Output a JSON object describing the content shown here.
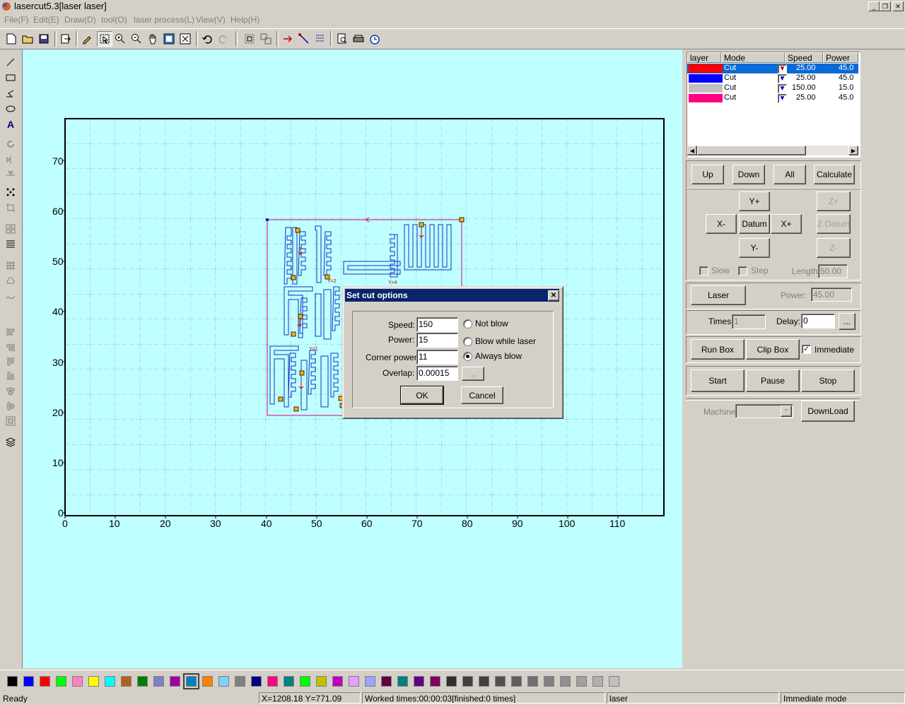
{
  "window": {
    "title": "lasercut5.3[laser laser]"
  },
  "menu": [
    "File(F)",
    "Edit(E)",
    "Draw(D)",
    "tool(O)",
    "laser process(L)",
    "View(V)",
    "Help(H)"
  ],
  "canvas": {
    "y_ticks": [
      "70",
      "60",
      "50",
      "40",
      "30",
      "20",
      "10",
      "0"
    ],
    "x_ticks": [
      "0",
      "10",
      "20",
      "30",
      "40",
      "50",
      "60",
      "70",
      "80",
      "90",
      "100",
      "110"
    ]
  },
  "layers": {
    "headers": [
      "layer",
      "Mode",
      "Speed",
      "Power"
    ],
    "rows": [
      {
        "color": "#ff0000",
        "mode": "Cut",
        "speed": "25.00",
        "power": "45.0",
        "selected": true
      },
      {
        "color": "#0000ff",
        "mode": "Cut",
        "speed": "25.00",
        "power": "45.0",
        "selected": false
      },
      {
        "color": "#c0c0c0",
        "mode": "Cut",
        "speed": "150.00",
        "power": "15.0",
        "selected": false
      },
      {
        "color": "#ff0080",
        "mode": "Cut",
        "speed": "25.00",
        "power": "45.0",
        "selected": false
      }
    ]
  },
  "panel": {
    "up": "Up",
    "down": "Down",
    "all": "All",
    "calculate": "Calculate",
    "yplus": "Y+",
    "xminus": "X-",
    "datum": "Datum",
    "xplus": "X+",
    "yminus": "Y-",
    "zplus": "Z+",
    "zdatum": "Z Datum",
    "zminus": "Z-",
    "slow": "Slow",
    "step": "Step",
    "length_label": "Length:",
    "length_value": "50.00",
    "laser": "Laser",
    "power_label": "Power:",
    "power_value": "45.00",
    "times_label": "Times:",
    "times_value": "1",
    "delay_label": "Delay:",
    "delay_value": "0",
    "ellipsis": "...",
    "runbox": "Run Box",
    "clipbox": "Clip Box",
    "immediate": "Immediate",
    "start": "Start",
    "pause": "Pause",
    "stop": "Stop",
    "machine_label": "Machine:",
    "download": "DownLoad"
  },
  "dialog": {
    "title": "Set cut options",
    "speed_label": "Speed:",
    "speed_value": "150",
    "power_label": "Power:",
    "power_value": "15",
    "corner_label": "Corner power:",
    "corner_value": "11",
    "overlap_label": "Overlap:",
    "overlap_value": "0.00015",
    "ellipsis": "...",
    "radio_not_blow": "Not blow",
    "radio_blow_laser": "Blow while laser",
    "radio_always": "Always blow",
    "selected_radio": "Always blow",
    "ok": "OK",
    "cancel": "Cancel"
  },
  "palette": [
    "#000000",
    "#0000ff",
    "#ff0000",
    "#00ff00",
    "#ff80c0",
    "#ffff00",
    "#00ffff",
    "#b06020",
    "#008000",
    "#8080c0",
    "#a000a0",
    "#0080c0",
    "#ff8000",
    "#80d0ff",
    "#808080",
    "#000080",
    "#ff0080",
    "#008080",
    "#00ff00",
    "#c0c000",
    "#c000c0",
    "#e0a0ff",
    "#a0a0ff",
    "#600040",
    "#008080",
    "#600080",
    "#800060",
    "#303030",
    "#404040",
    "#404040",
    "#505050",
    "#606060",
    "#707070",
    "#808080",
    "#909090",
    "#a0a0a0",
    "#b0b0b0",
    "#c0c0c0"
  ],
  "status": {
    "ready": "Ready",
    "coords": "X=1208.18 Y=771.09",
    "worked": "Worked times:00:00:03[finished:0 times]",
    "device": "laser",
    "mode": "Immediate mode"
  }
}
